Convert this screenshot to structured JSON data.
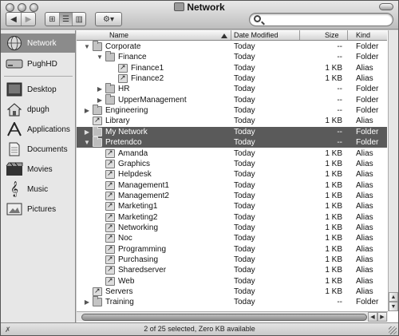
{
  "window": {
    "title": "Network"
  },
  "toolbar": {
    "back_glyph": "◀",
    "forward_glyph": "▶",
    "views": [
      {
        "name": "icon-view",
        "glyph": "⊞"
      },
      {
        "name": "list-view",
        "glyph": "☰"
      },
      {
        "name": "column-view",
        "glyph": "▥"
      }
    ],
    "action_glyph": "⚙▾",
    "search_placeholder": ""
  },
  "sidebar": {
    "items": [
      {
        "label": "Network",
        "icon": "network-globe-icon"
      },
      {
        "label": "PughHD",
        "icon": "hard-drive-icon"
      },
      {
        "label": "Desktop",
        "icon": "desktop-icon"
      },
      {
        "label": "dpugh",
        "icon": "home-icon"
      },
      {
        "label": "Applications",
        "icon": "applications-icon"
      },
      {
        "label": "Documents",
        "icon": "documents-icon"
      },
      {
        "label": "Movies",
        "icon": "movies-icon"
      },
      {
        "label": "Music",
        "icon": "music-icon"
      },
      {
        "label": "Pictures",
        "icon": "pictures-icon"
      }
    ]
  },
  "list": {
    "columns": {
      "name": "Name",
      "date": "Date Modified",
      "size": "Size",
      "kind": "Kind"
    },
    "rows": [
      {
        "name": "Corporate",
        "date": "Today",
        "size": "--",
        "kind": "Folder",
        "level": 0,
        "disclosure": "open",
        "icon": "folder-icon"
      },
      {
        "name": "Finance",
        "date": "Today",
        "size": "--",
        "kind": "Folder",
        "level": 1,
        "disclosure": "open",
        "icon": "folder-icon"
      },
      {
        "name": "Finance1",
        "date": "Today",
        "size": "1 KB",
        "kind": "Alias",
        "level": 2,
        "disclosure": "none",
        "icon": "alias-icon"
      },
      {
        "name": "Finance2",
        "date": "Today",
        "size": "1 KB",
        "kind": "Alias",
        "level": 2,
        "disclosure": "none",
        "icon": "alias-icon"
      },
      {
        "name": "HR",
        "date": "Today",
        "size": "--",
        "kind": "Folder",
        "level": 1,
        "disclosure": "closed",
        "icon": "folder-icon"
      },
      {
        "name": "UpperManagement",
        "date": "Today",
        "size": "--",
        "kind": "Folder",
        "level": 1,
        "disclosure": "closed",
        "icon": "folder-icon"
      },
      {
        "name": "Engineering",
        "date": "Today",
        "size": "--",
        "kind": "Folder",
        "level": 0,
        "disclosure": "closed",
        "icon": "folder-icon"
      },
      {
        "name": "Library",
        "date": "Today",
        "size": "1 KB",
        "kind": "Alias",
        "level": 0,
        "disclosure": "none",
        "icon": "alias-icon"
      },
      {
        "name": "My Network",
        "date": "Today",
        "size": "--",
        "kind": "Folder",
        "level": 0,
        "disclosure": "closed",
        "icon": "folder-icon",
        "selected": true
      },
      {
        "name": "Pretendco",
        "date": "Today",
        "size": "--",
        "kind": "Folder",
        "level": 0,
        "disclosure": "open",
        "icon": "folder-icon",
        "selected": true
      },
      {
        "name": "Amanda",
        "date": "Today",
        "size": "1 KB",
        "kind": "Alias",
        "level": 1,
        "disclosure": "none",
        "icon": "alias-icon"
      },
      {
        "name": "Graphics",
        "date": "Today",
        "size": "1 KB",
        "kind": "Alias",
        "level": 1,
        "disclosure": "none",
        "icon": "alias-icon"
      },
      {
        "name": "Helpdesk",
        "date": "Today",
        "size": "1 KB",
        "kind": "Alias",
        "level": 1,
        "disclosure": "none",
        "icon": "alias-icon"
      },
      {
        "name": "Management1",
        "date": "Today",
        "size": "1 KB",
        "kind": "Alias",
        "level": 1,
        "disclosure": "none",
        "icon": "alias-icon"
      },
      {
        "name": "Management2",
        "date": "Today",
        "size": "1 KB",
        "kind": "Alias",
        "level": 1,
        "disclosure": "none",
        "icon": "alias-icon"
      },
      {
        "name": "Marketing1",
        "date": "Today",
        "size": "1 KB",
        "kind": "Alias",
        "level": 1,
        "disclosure": "none",
        "icon": "alias-icon"
      },
      {
        "name": "Marketing2",
        "date": "Today",
        "size": "1 KB",
        "kind": "Alias",
        "level": 1,
        "disclosure": "none",
        "icon": "alias-icon"
      },
      {
        "name": "Networking",
        "date": "Today",
        "size": "1 KB",
        "kind": "Alias",
        "level": 1,
        "disclosure": "none",
        "icon": "alias-icon"
      },
      {
        "name": "Noc",
        "date": "Today",
        "size": "1 KB",
        "kind": "Alias",
        "level": 1,
        "disclosure": "none",
        "icon": "alias-icon"
      },
      {
        "name": "Programming",
        "date": "Today",
        "size": "1 KB",
        "kind": "Alias",
        "level": 1,
        "disclosure": "none",
        "icon": "alias-icon"
      },
      {
        "name": "Purchasing",
        "date": "Today",
        "size": "1 KB",
        "kind": "Alias",
        "level": 1,
        "disclosure": "none",
        "icon": "alias-icon"
      },
      {
        "name": "Sharedserver",
        "date": "Today",
        "size": "1 KB",
        "kind": "Alias",
        "level": 1,
        "disclosure": "none",
        "icon": "alias-icon"
      },
      {
        "name": "Web",
        "date": "Today",
        "size": "1 KB",
        "kind": "Alias",
        "level": 1,
        "disclosure": "none",
        "icon": "alias-icon"
      },
      {
        "name": "Servers",
        "date": "Today",
        "size": "1 KB",
        "kind": "Alias",
        "level": 0,
        "disclosure": "none",
        "icon": "alias-icon"
      },
      {
        "name": "Training",
        "date": "Today",
        "size": "--",
        "kind": "Folder",
        "level": 0,
        "disclosure": "closed",
        "icon": "folder-icon"
      }
    ]
  },
  "status": {
    "text": "2 of 25 selected, Zero KB available"
  },
  "colors": {
    "selection": "#5a5a5a",
    "sidebar_selection": "#8b8b8b",
    "sidebar_bg": "#e7e7e7"
  }
}
